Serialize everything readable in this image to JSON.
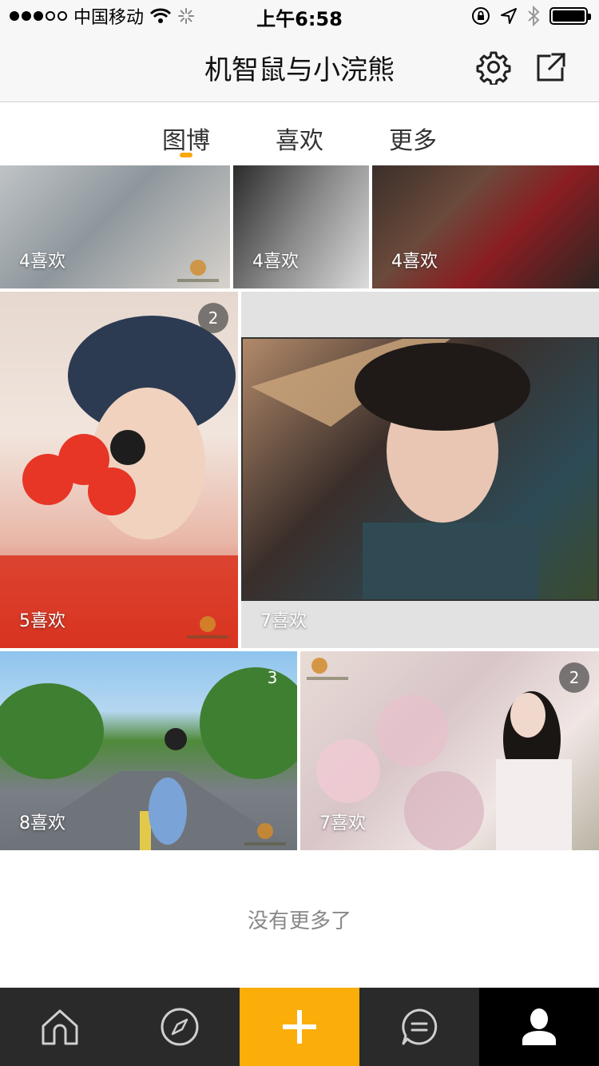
{
  "status_bar": {
    "carrier": "中国移动",
    "time": "上午6:58"
  },
  "nav": {
    "title": "机智鼠与小浣熊",
    "settings_icon": "gear-icon",
    "share_icon": "share-external-icon"
  },
  "tabs": [
    {
      "label": "图博",
      "active": true
    },
    {
      "label": "喜欢",
      "active": false
    },
    {
      "label": "更多",
      "active": false
    }
  ],
  "tiles": [
    {
      "likes": "4喜欢"
    },
    {
      "likes": "4喜欢"
    },
    {
      "likes": "4喜欢"
    },
    {
      "likes": "5喜欢",
      "count": "2"
    },
    {
      "likes": "7喜欢"
    },
    {
      "likes": "8喜欢",
      "count": "3"
    },
    {
      "likes": "7喜欢",
      "count": "2"
    }
  ],
  "footer": {
    "no_more": "没有更多了"
  },
  "tab_bar": {
    "items": [
      "home-icon",
      "compass-icon",
      "plus-icon",
      "message-icon",
      "person-icon"
    ],
    "accent": "#fbad0a"
  },
  "colors": {
    "accent": "#f8a70a",
    "tab_bar_bg": "#2a2a2a"
  }
}
